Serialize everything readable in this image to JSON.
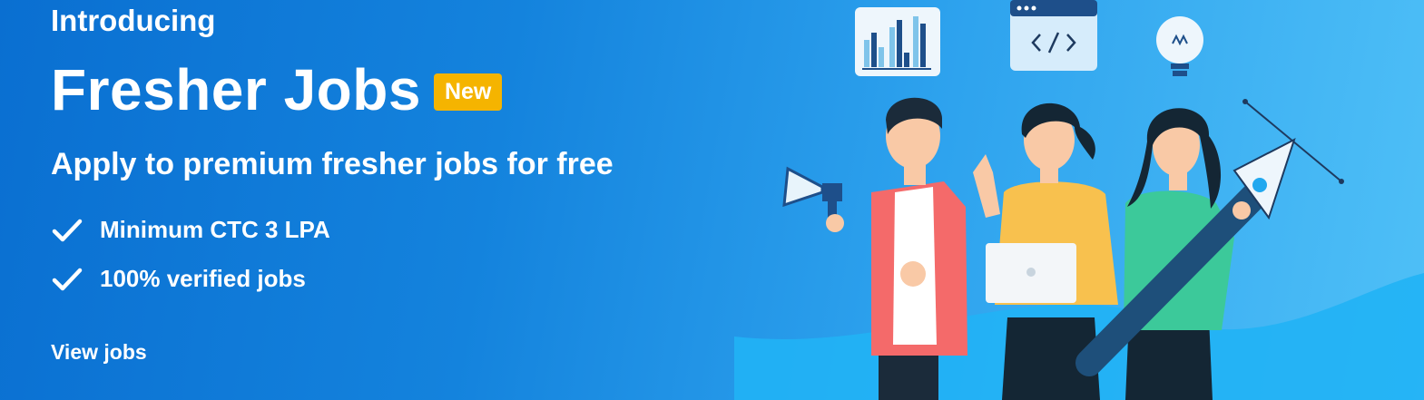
{
  "banner": {
    "intro": "Introducing",
    "title": "Fresher Jobs",
    "badge": "New",
    "subtitle": "Apply to premium fresher jobs for free",
    "features": [
      {
        "icon": "check-icon",
        "label": "Minimum CTC 3 LPA"
      },
      {
        "icon": "check-icon",
        "label": "100% verified jobs"
      }
    ],
    "cta": "View jobs"
  },
  "colors": {
    "background_start": "#0a6fd1",
    "background_end": "#4fc0f7",
    "badge": "#f5b400",
    "text": "#ffffff"
  }
}
